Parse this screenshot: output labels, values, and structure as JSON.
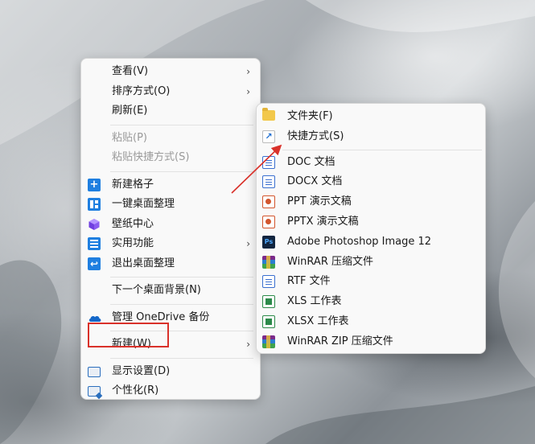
{
  "main_menu": {
    "items": [
      {
        "label": "查看(V)",
        "has_submenu": true
      },
      {
        "label": "排序方式(O)",
        "has_submenu": true
      },
      {
        "label": "刷新(E)"
      },
      {
        "label": "粘贴(P)",
        "disabled": true
      },
      {
        "label": "粘贴快捷方式(S)",
        "disabled": true
      },
      {
        "label": "新建格子",
        "icon": "plus-square-icon"
      },
      {
        "label": "一键桌面整理",
        "icon": "layout-icon"
      },
      {
        "label": "壁纸中心",
        "icon": "cube-icon"
      },
      {
        "label": "实用功能",
        "icon": "list-icon",
        "has_submenu": true
      },
      {
        "label": "退出桌面整理",
        "icon": "exit-icon"
      },
      {
        "label": "下一个桌面背景(N)"
      },
      {
        "label": "管理 OneDrive 备份",
        "icon": "onedrive-cloud-icon"
      },
      {
        "label": "新建(W)",
        "has_submenu": true,
        "highlighted": true
      },
      {
        "label": "显示设置(D)",
        "icon": "display-icon"
      },
      {
        "label": "个性化(R)",
        "icon": "personalize-icon"
      }
    ]
  },
  "sub_menu": {
    "items": [
      {
        "label": "文件夹(F)",
        "icon": "folder-icon"
      },
      {
        "label": "快捷方式(S)",
        "icon": "shortcut-icon"
      },
      {
        "label": "DOC 文档",
        "icon": "doc-file-icon"
      },
      {
        "label": "DOCX 文档",
        "icon": "docx-file-icon"
      },
      {
        "label": "PPT 演示文稿",
        "icon": "ppt-file-icon"
      },
      {
        "label": "PPTX 演示文稿",
        "icon": "pptx-file-icon"
      },
      {
        "label": "Adobe Photoshop Image 12",
        "icon": "photoshop-file-icon"
      },
      {
        "label": "WinRAR 压缩文件",
        "icon": "winrar-icon"
      },
      {
        "label": "RTF 文件",
        "icon": "rtf-file-icon"
      },
      {
        "label": "XLS 工作表",
        "icon": "xls-file-icon"
      },
      {
        "label": "XLSX 工作表",
        "icon": "xlsx-file-icon"
      },
      {
        "label": "WinRAR ZIP 压缩文件",
        "icon": "winrar-zip-icon"
      }
    ]
  },
  "arrow_glyph": "›",
  "annotation_color": "#d9312a",
  "accent_color": "#1f7fe0"
}
